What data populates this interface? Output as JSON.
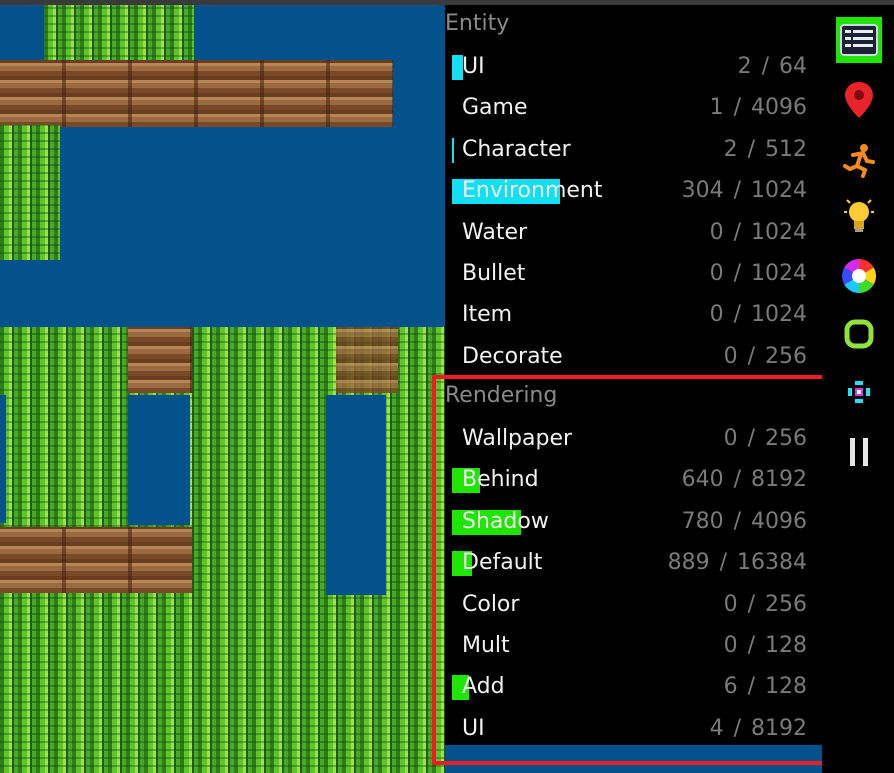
{
  "panel": {
    "entity": {
      "header": "Entity",
      "rows": [
        {
          "label": "UI",
          "count": "2",
          "max": "64",
          "bar_color": "#11e0f2",
          "fill": 0.03
        },
        {
          "label": "Game",
          "count": "1",
          "max": "4096",
          "bar_color": "#11e0f2",
          "fill": 0.0
        },
        {
          "label": "Character",
          "count": "2",
          "max": "512",
          "bar_color": "#11e0f2",
          "fill": 0.004
        },
        {
          "label": "Environment",
          "count": "304",
          "max": "1024",
          "bar_color": "#11e0f2",
          "fill": 0.297
        },
        {
          "label": "Water",
          "count": "0",
          "max": "1024",
          "bar_color": "#11e0f2",
          "fill": 0
        },
        {
          "label": "Bullet",
          "count": "0",
          "max": "1024",
          "bar_color": "#11e0f2",
          "fill": 0
        },
        {
          "label": "Item",
          "count": "0",
          "max": "1024",
          "bar_color": "#11e0f2",
          "fill": 0
        },
        {
          "label": "Decorate",
          "count": "0",
          "max": "256",
          "bar_color": "#11e0f2",
          "fill": 0
        }
      ]
    },
    "rendering": {
      "header": "Rendering",
      "rows": [
        {
          "label": "Wallpaper",
          "count": "0",
          "max": "256",
          "bar_color": "#1ee600",
          "fill": 0
        },
        {
          "label": "Behind",
          "count": "640",
          "max": "8192",
          "bar_color": "#1ee600",
          "fill": 0.078
        },
        {
          "label": "Shadow",
          "count": "780",
          "max": "4096",
          "bar_color": "#1ee600",
          "fill": 0.19
        },
        {
          "label": "Default",
          "count": "889",
          "max": "16384",
          "bar_color": "#1ee600",
          "fill": 0.054
        },
        {
          "label": "Color",
          "count": "0",
          "max": "256",
          "bar_color": "#1ee600",
          "fill": 0
        },
        {
          "label": "Mult",
          "count": "0",
          "max": "128",
          "bar_color": "#1ee600",
          "fill": 0
        },
        {
          "label": "Add",
          "count": "6",
          "max": "128",
          "bar_color": "#1ee600",
          "fill": 0.047
        },
        {
          "label": "UI",
          "count": "4",
          "max": "8192",
          "bar_color": "#1ee600",
          "fill": 0.0
        }
      ]
    },
    "separator": "/"
  },
  "toolbar": {
    "items": [
      {
        "name": "entity-panel-icon",
        "active": true
      },
      {
        "name": "map-pin-icon",
        "active": false
      },
      {
        "name": "running-character-icon",
        "active": false
      },
      {
        "name": "light-bulb-icon",
        "active": false
      },
      {
        "name": "color-wheel-icon",
        "active": false
      },
      {
        "name": "rounded-square-icon",
        "active": false
      },
      {
        "name": "particle-icon",
        "active": false
      },
      {
        "name": "pause-icon",
        "active": false
      }
    ],
    "active_color": "#1ee600"
  },
  "scene": {
    "background_color": "#04528c"
  }
}
